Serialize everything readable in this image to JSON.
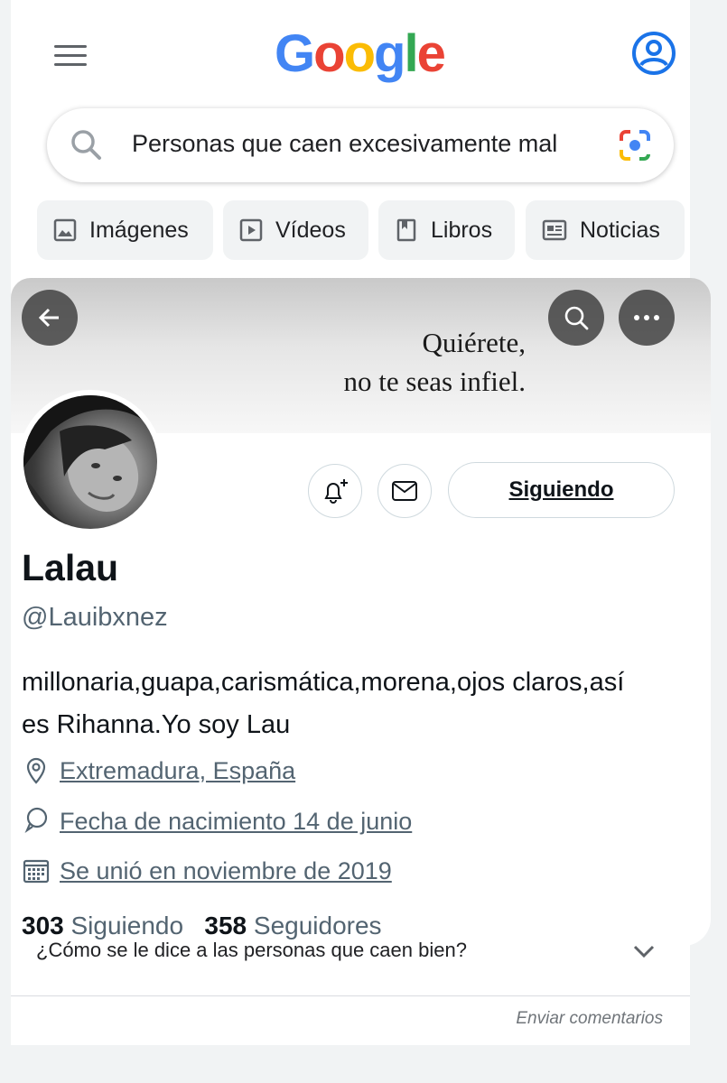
{
  "google": {
    "logo_letters": [
      {
        "ch": "G",
        "color": "#4285F4"
      },
      {
        "ch": "o",
        "color": "#EA4335"
      },
      {
        "ch": "o",
        "color": "#FBBC05"
      },
      {
        "ch": "g",
        "color": "#4285F4"
      },
      {
        "ch": "l",
        "color": "#34A853"
      },
      {
        "ch": "e",
        "color": "#EA4335"
      }
    ],
    "search_query": "Personas que caen excesivamente mal",
    "chips": [
      {
        "label": "Imágenes",
        "icon": "image-icon"
      },
      {
        "label": "Vídeos",
        "icon": "play-icon"
      },
      {
        "label": "Libros",
        "icon": "book-icon"
      },
      {
        "label": "Noticias",
        "icon": "news-icon"
      }
    ],
    "faq_question": "¿Cómo se le dice a las personas que caen bien?",
    "feedback_label": "Enviar comentarios"
  },
  "profile": {
    "banner_line1": "Quiérete,",
    "banner_line2": "no te seas infiel.",
    "name": "Lalau",
    "handle": "@Lauibxnez",
    "bio": "millonaria,guapa,carismática,morena,ojos claros,así es Rihanna.Yo soy Lau",
    "location": "Extremadura, España",
    "birthday": "Fecha de nacimiento 14 de junio",
    "joined": "Se unió en noviembre de 2019",
    "following_count": "303",
    "following_label": "Siguiendo",
    "followers_count": "358",
    "followers_label": "Seguidores",
    "follow_button_label": "Siguiendo"
  },
  "colors": {
    "google_blue": "#4285F4",
    "text_secondary": "#536471",
    "text_primary": "#0f1419"
  }
}
